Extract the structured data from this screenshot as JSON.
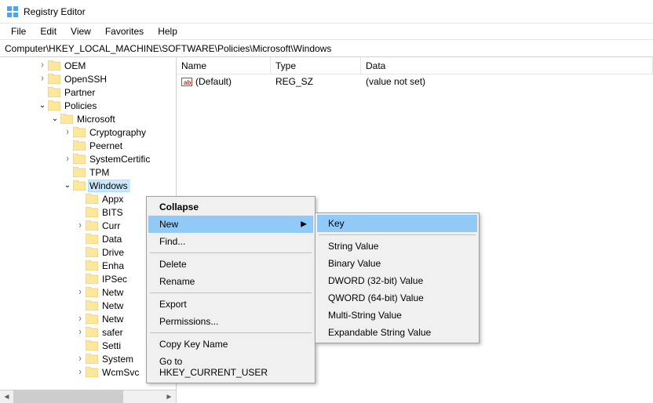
{
  "window": {
    "title": "Registry Editor"
  },
  "menubar": {
    "file": "File",
    "edit": "Edit",
    "view": "View",
    "favorites": "Favorites",
    "help": "Help"
  },
  "address": "Computer\\HKEY_LOCAL_MACHINE\\SOFTWARE\\Policies\\Microsoft\\Windows",
  "tree": {
    "items": [
      {
        "indent": 3,
        "expander": ">",
        "label": "OEM"
      },
      {
        "indent": 3,
        "expander": ">",
        "label": "OpenSSH"
      },
      {
        "indent": 3,
        "expander": "",
        "label": "Partner"
      },
      {
        "indent": 3,
        "expander": "v",
        "label": "Policies"
      },
      {
        "indent": 4,
        "expander": "v",
        "label": "Microsoft"
      },
      {
        "indent": 5,
        "expander": ">",
        "label": "Cryptography"
      },
      {
        "indent": 5,
        "expander": "",
        "label": "Peernet"
      },
      {
        "indent": 5,
        "expander": ">",
        "label": "SystemCertific"
      },
      {
        "indent": 5,
        "expander": "",
        "label": "TPM"
      },
      {
        "indent": 5,
        "expander": "v",
        "label": "Windows",
        "selected": true
      },
      {
        "indent": 6,
        "expander": "",
        "label": "Appx"
      },
      {
        "indent": 6,
        "expander": "",
        "label": "BITS"
      },
      {
        "indent": 6,
        "expander": ">",
        "label": "Curr"
      },
      {
        "indent": 6,
        "expander": "",
        "label": "Data"
      },
      {
        "indent": 6,
        "expander": "",
        "label": "Drive"
      },
      {
        "indent": 6,
        "expander": "",
        "label": "Enha"
      },
      {
        "indent": 6,
        "expander": "",
        "label": "IPSec"
      },
      {
        "indent": 6,
        "expander": ">",
        "label": "Netw"
      },
      {
        "indent": 6,
        "expander": "",
        "label": "Netw"
      },
      {
        "indent": 6,
        "expander": ">",
        "label": "Netw"
      },
      {
        "indent": 6,
        "expander": ">",
        "label": "safer"
      },
      {
        "indent": 6,
        "expander": "",
        "label": "Setti"
      },
      {
        "indent": 6,
        "expander": ">",
        "label": "System"
      },
      {
        "indent": 6,
        "expander": ">",
        "label": "WcmSvc"
      }
    ]
  },
  "list": {
    "headers": {
      "name": "Name",
      "type": "Type",
      "data": "Data"
    },
    "rows": [
      {
        "name": "(Default)",
        "type": "REG_SZ",
        "data": "(value not set)"
      }
    ]
  },
  "context_menu": {
    "collapse": "Collapse",
    "new": "New",
    "find": "Find...",
    "delete": "Delete",
    "rename": "Rename",
    "export": "Export",
    "permissions": "Permissions...",
    "copy_key_name": "Copy Key Name",
    "go_to_hkcu": "Go to HKEY_CURRENT_USER"
  },
  "submenu_new": {
    "key": "Key",
    "string": "String Value",
    "binary": "Binary Value",
    "dword": "DWORD (32-bit) Value",
    "qword": "QWORD (64-bit) Value",
    "multi_string": "Multi-String Value",
    "expandable_string": "Expandable String Value"
  }
}
